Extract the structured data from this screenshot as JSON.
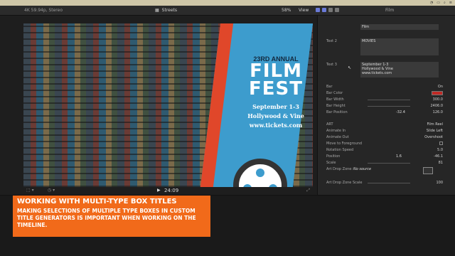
{
  "header": {
    "format": "4K 59.94p, Stereo",
    "project": "Streets",
    "zoom": "58%",
    "view": "View",
    "panel_title": "Film"
  },
  "viewer": {
    "poster": {
      "annual": "23RD ANNUAL",
      "title_line1": "FILM",
      "title_line2": "FEST",
      "dates": "September 1-3",
      "venue": "Hollywood & Vine",
      "website": "www.tickets.com"
    },
    "timecode": "24:09"
  },
  "inspector": {
    "text1_value": "Film",
    "text2_label": "Text 2",
    "text2_value": "MOVIES",
    "text3_label": "Text 3",
    "text3_lines": [
      "September 1-3",
      "Hollywood & Vine",
      "www.tickets.com"
    ],
    "bar_label": "Bar",
    "bar_value": "On",
    "bar_color_label": "Bar Color",
    "bar_width_label": "Bar Width",
    "bar_width_value": "300.0",
    "bar_height_label": "Bar Height",
    "bar_height_value": "2406.0",
    "bar_position_label": "Bar Position",
    "bar_position_x": "-32.4",
    "bar_position_y": "126.0",
    "art_label": "ART",
    "art_value": "Film Reel",
    "animate_in_label": "Animate In",
    "animate_in_value": "Slide Left",
    "animate_out_label": "Animate Out",
    "animate_out_value": "Overshoot",
    "move_fg_label": "Move to Foreground",
    "rotation_speed_label": "Rotation Speed",
    "rotation_speed_value": "5.0",
    "position_label": "Position",
    "position_x": "1.6",
    "position_y": "-46.1",
    "scale_label": "Scale",
    "scale_value": "81",
    "drop_zone_label": "Art Drop Zone:",
    "drop_zone_value": "No source",
    "drop_zone_scale_label": "Art Drop Zone Scale",
    "drop_zone_scale_value": "100"
  },
  "caption": {
    "title": "WORKING WITH MULTI-TYPE BOX TITLES",
    "body": "MAKING SELECTIONS OF MULTIPLE TYPE BOXES IN CUSTOM TITLE GENERATORS IS IMPORTANT WHEN WORKING ON THE TIMELINE."
  },
  "colors": {
    "caption_bg": "#f16a1a",
    "banner_blue": "#3d9ccd",
    "bar_color": "#c02a25"
  }
}
